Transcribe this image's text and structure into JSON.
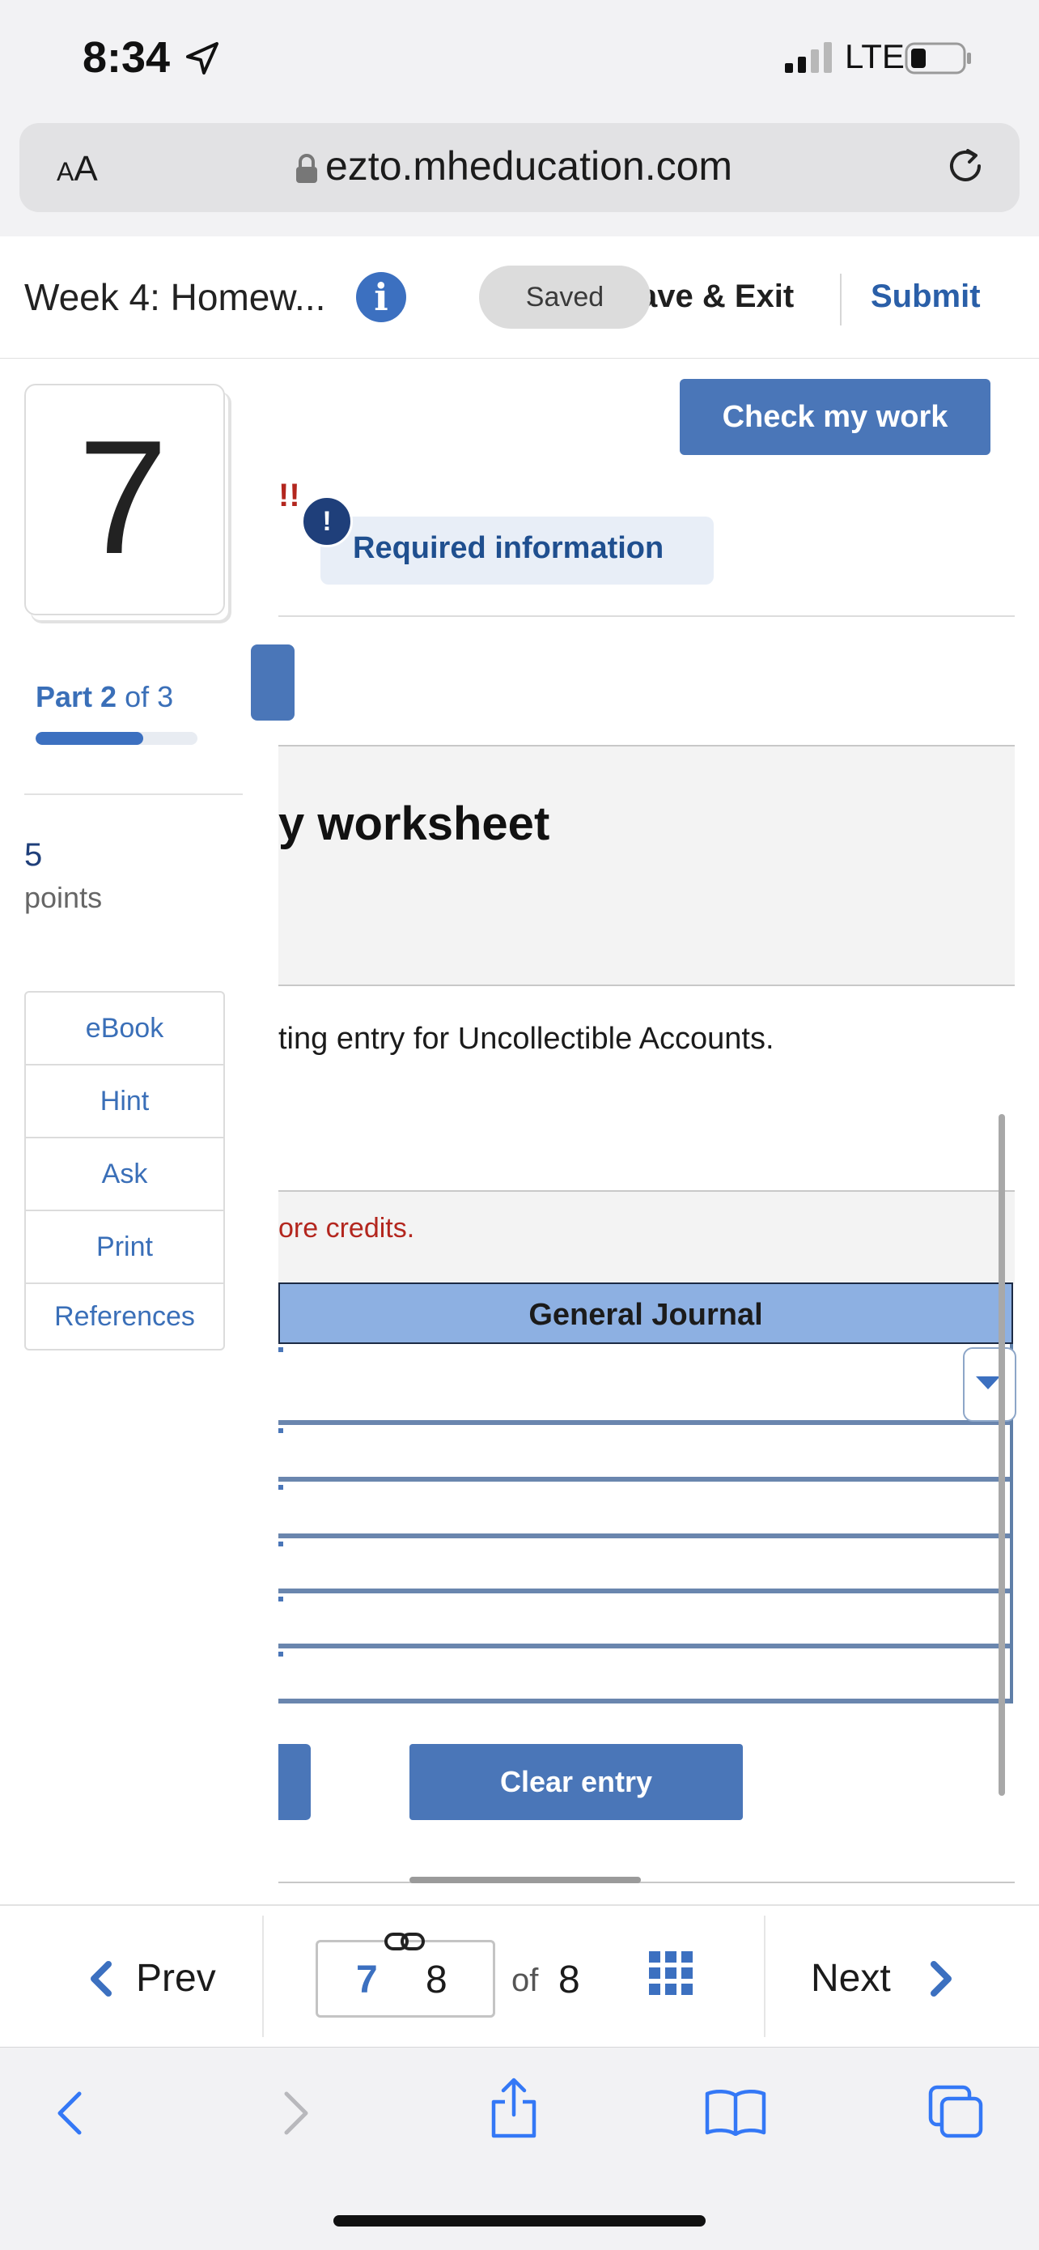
{
  "status_bar": {
    "time": "8:34",
    "carrier": "LTE"
  },
  "browser": {
    "text_size_label_small": "A",
    "text_size_label_large": "A",
    "url": "ezto.mheducation.com"
  },
  "header": {
    "assignment_title": "Week 4: Homew...",
    "info_label": "i",
    "saved_label": "Saved",
    "save_exit_label": "ave & Exit",
    "submit_label": "Submit"
  },
  "sidebar": {
    "question_number": "7",
    "part_prefix": "Part",
    "part_current": "2",
    "part_of": "of 3",
    "part_progress_fraction": 0.667,
    "points_value": "5",
    "points_label": "points",
    "tools": [
      "eBook",
      "Hint",
      "Ask",
      "Print",
      "References"
    ]
  },
  "main": {
    "check_work_label": "Check my work",
    "warning_text": "!!",
    "required_icon": "!",
    "required_label": "Required information",
    "worksheet_title": "y worksheet",
    "instruction": "ting entry for Uncollectible Accounts.",
    "credit_note": "ore credits.",
    "journal_header": "General Journal",
    "clear_entry_label": "Clear entry"
  },
  "qnav": {
    "prev_label": "Prev",
    "page_current": "7",
    "page_total_in_box": "8",
    "page_of": "of",
    "page_total": "8",
    "next_label": "Next"
  },
  "colors": {
    "accent": "#3c70c0",
    "button": "#4a76b8",
    "error": "#b3261e",
    "journal_header": "#8db0e2"
  }
}
